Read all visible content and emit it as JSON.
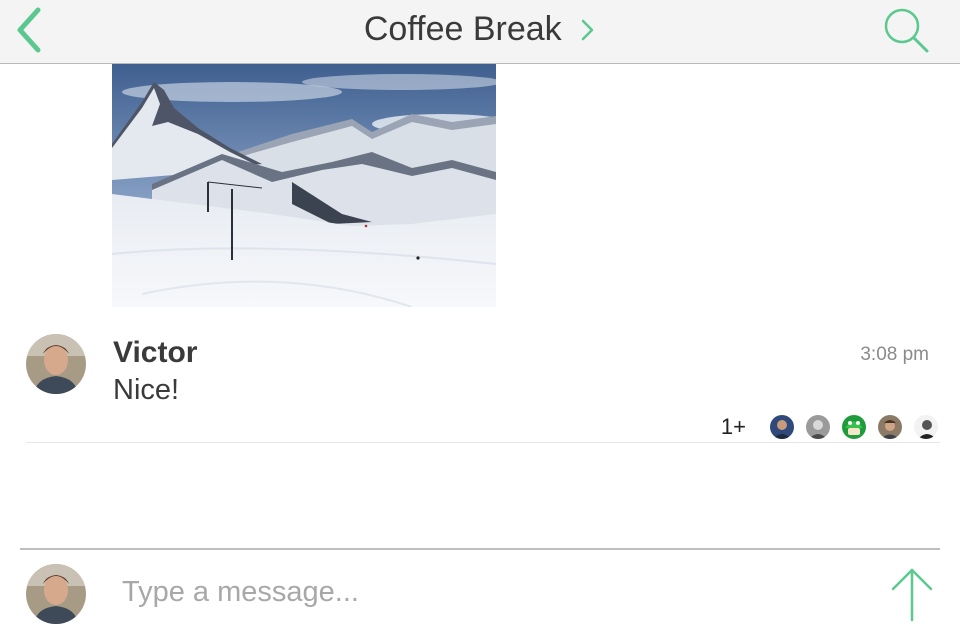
{
  "header": {
    "title": "Coffee Break",
    "back_icon": "chevron-left-icon",
    "title_icon": "chevron-right-icon",
    "search_icon": "search-icon"
  },
  "photo": {
    "subject": "snowy-mountain-photo"
  },
  "message": {
    "sender": "Victor",
    "text": "Nice!",
    "time": "3:08 pm",
    "read_receipts": {
      "more_count": "1+",
      "avatar_count": 5
    }
  },
  "composer": {
    "placeholder": "Type a message...",
    "send_icon": "arrow-up-icon"
  },
  "colors": {
    "accent": "#5bc88f",
    "header_bg": "#f4f4f4",
    "text": "#3a3a3a",
    "muted": "#8b8b8b",
    "placeholder": "#a8a8a8"
  }
}
